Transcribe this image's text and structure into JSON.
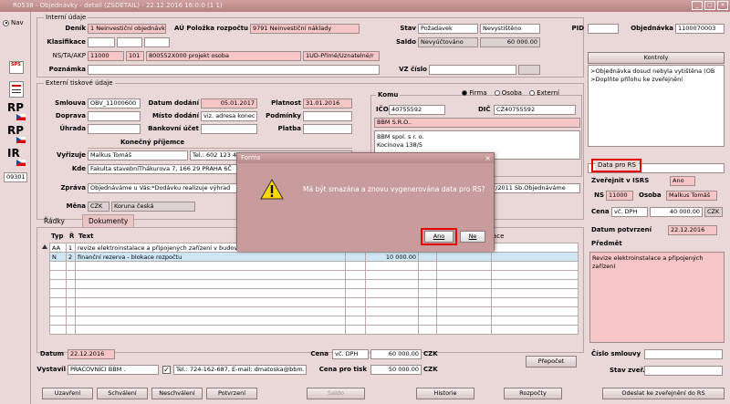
{
  "window": {
    "title": "R0538 - Objednávky - detail (ZSDETAIL) - 22.12.2016  16:0:0 (1 1)"
  },
  "sidebar": {
    "nav_label": "Nav",
    "sps_label": "SPS",
    "rp1_label": "RP",
    "rp2_label": "RP",
    "ir_label": "IR",
    "code": "09301"
  },
  "header": {
    "group_label": "Interní údaje",
    "denik_label": "Deník",
    "denik_value": "1 Neinvestiční objednávk",
    "au_label": "AÚ Položka rozpočtu",
    "au_value": "9791 Neinvestiční náklady",
    "stav_label": "Stav",
    "stav_value1": "Požadavek",
    "stav_value2": "Nevystištěno",
    "pid_label": "PID",
    "objednavka_label": "Objednávka",
    "objednavka_value": "1100070003",
    "klasifikace_label": "Klasifikace",
    "saldo_label": "Saldo",
    "saldo_state": "Nevyúčtováno",
    "saldo_value": "60 000.00",
    "nsta_label": "NS/TA/AKP",
    "nsta_1": "11000",
    "nsta_2": "101",
    "nsta_3": "800552X000 projekt osoba",
    "nsta_4": "1UD-Přímé/Uznatelné/r",
    "poznamka_label": "Poznámka",
    "vzcislo_label": "VZ číslo"
  },
  "kontroly": {
    "label": "Kontroly",
    "items": [
      ">Objednávka dosud nebyla vytištěna (OB",
      ">Doplňte přílohu ke zveřejnění"
    ]
  },
  "external": {
    "group_label": "Externí tiskové údaje",
    "smlouva_label": "Smlouva",
    "smlouva_value": "OBV_11000600",
    "datum_dodani_label": "Datum dodání",
    "datum_dodani_value": "05.01.2017",
    "platnost_label": "Platnost",
    "platnost_value": "31.01.2016",
    "doprava_label": "Doprava",
    "misto_dodani_label": "Místo dodání",
    "misto_dodani_value": "viz. adresa konec",
    "podminky_label": "Podmínky",
    "uhrada_label": "Úhrada",
    "bankovni_label": "Bankovní účet",
    "platba_label": "Platba",
    "konecny_label": "Konečný příjemce",
    "vyrizuje_label": "Vyřizuje",
    "vyrizuje_value": "Malkus Tomáš",
    "vyrizuje_tel": "Tel.: 602 123 4",
    "kde_label": "Kde",
    "kde_value": "Fakulta stavebníThákurova 7, 166 29 PRAHA 6Č",
    "zprava_label": "Zpráva",
    "zprava_value": "Objednáváme u Vás:*Dodávku realizuje výhrad",
    "zprava_right": "7/2011 Sb.Objednáváme",
    "mena_label": "Měna",
    "mena_code": "CZK",
    "mena_name": "Koruna česká"
  },
  "komu": {
    "label": "Komu",
    "radio_firma": "Firma",
    "radio_osoba": "Osoba",
    "radio_externi": "Externí",
    "ico_label": "IČO",
    "ico_value": "40755592",
    "dic_label": "DIČ",
    "dic_value": "CZ40755592",
    "firm_short": "BBM S.R.O..",
    "address": [
      "BBM spol. s r. o.",
      "Kocínova 138/5"
    ]
  },
  "rs": {
    "label": "Data pro RS",
    "zverejnit_label": "Zveřejnit v ISRS",
    "zverejnit_value": "Ano",
    "ns_label": "NS",
    "ns_value": "11000",
    "osoba_label": "Osoba",
    "osoba_value": "Malkus Tomáš",
    "cena_label": "Cena",
    "cena_type": "vč. DPH",
    "cena_value": "40 000.00",
    "cena_cur": "CZK",
    "datum_potvrzeni_label": "Datum potvrzení",
    "datum_potvrzeni_value": "22.12.2016",
    "predmet_label": "Předmět",
    "predmet_value": "Revize elektroinstalace a připojených zařízení",
    "cislo_smlouvy_label": "Číslo smlouvy",
    "stav_zver_label": "Stav zveř."
  },
  "tabs": {
    "radky": "Řádky",
    "dokumenty": "Dokumenty"
  },
  "table": {
    "headers": [
      "Typ",
      "Ř",
      "Text",
      "",
      "kace"
    ],
    "rows": [
      {
        "typ": "AA",
        "r": "1",
        "text": "revize elektroinstalace a připojených zařízení v budově B",
        "amount": ""
      },
      {
        "typ": "N",
        "r": "2",
        "text": "finanční rezerva - blokace rozpočtu",
        "amount": "10 000.00"
      }
    ]
  },
  "footer": {
    "datum_label": "Datum",
    "datum_value": "22.12.2016",
    "vystavil_label": "Vystavil",
    "vystavil_value": "PRACOVNÍCI BBM .",
    "tel_value": "Tel.: 724-162-687, E-mail: dmatoska@bbm.",
    "cena_label": "Cena",
    "cena_type": "vč. DPH",
    "cena_value": "60 000.00",
    "cena_cur": "CZK",
    "cena_tisk_label": "Cena pro tisk",
    "cena_tisk_value": "50 000.00",
    "cena_tisk_cur": "CZK",
    "prepocet": "Přepočet"
  },
  "buttons": {
    "uzavreni": "Uzavření",
    "schvaleni": "Schválení",
    "neschvaleni": "Neschválení",
    "potvrzeni": "Potvrzení",
    "saldo": "Saldo",
    "historie": "Historie",
    "rozpocty": "Rozpočty",
    "odeslat": "Odeslat ke zveřejnění do RS"
  },
  "dialog": {
    "title": "Forms",
    "message": "Má být smazána a znovu vygenerována data pro RS?",
    "yes": "Ano",
    "no": "Ne"
  },
  "colors": {
    "accent_red": "#e00000",
    "pink_field": "#f6c6c6",
    "background": "#ead8d8"
  }
}
